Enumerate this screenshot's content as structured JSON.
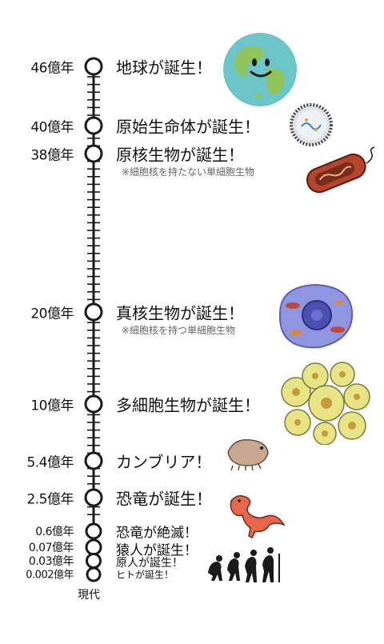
{
  "timeline": {
    "present_label": "現代",
    "events": [
      {
        "age": "46億年",
        "event": "地球が誕生！",
        "note": "",
        "icon": "earth-icon"
      },
      {
        "age": "40億年",
        "event": "原始生命体が誕生！",
        "note": "",
        "icon": "protocell-icon"
      },
      {
        "age": "38億年",
        "event": "原核生物が誕生！",
        "note": "※細胞核を持たない単細胞生物",
        "icon": "bacterium-icon"
      },
      {
        "age": "20億年",
        "event": "真核生物が誕生！",
        "note": "※細胞核を持つ単細胞生物",
        "icon": "eukaryotic-cell-icon"
      },
      {
        "age": "10億年",
        "event": "多細胞生物が誕生！",
        "note": "",
        "icon": "multicellular-cluster-icon"
      },
      {
        "age": "5.4億年",
        "event": "カンブリア！",
        "note": "",
        "icon": "cambrian-creature-icon"
      },
      {
        "age": "2.5億年",
        "event": "恐竜が誕生！",
        "note": "",
        "icon": "dinosaur-icon"
      },
      {
        "age": "0.6億年",
        "event": "恐竜が絶滅！",
        "note": "",
        "icon": "dinosaur-extinct-icon"
      },
      {
        "age": "0.07億年",
        "event": "猿人が誕生！",
        "note": "",
        "icon": ""
      },
      {
        "age": "0.03億年",
        "event": "原人が誕生！",
        "note": "",
        "icon": ""
      },
      {
        "age": "0.002億年",
        "event": "ヒトが誕生！",
        "note": "",
        "icon": "human-evolution-icon"
      }
    ]
  },
  "colors": {
    "line": "#1a1a1a",
    "earth_ocean": "#6cc6c9",
    "earth_land": "#8fc45a",
    "bacterium": "#b5452b",
    "eukaryote": "#8f95e0",
    "multicell": "#e7e486",
    "cambrian": "#c8a890",
    "dinosaur": "#e8664a"
  }
}
